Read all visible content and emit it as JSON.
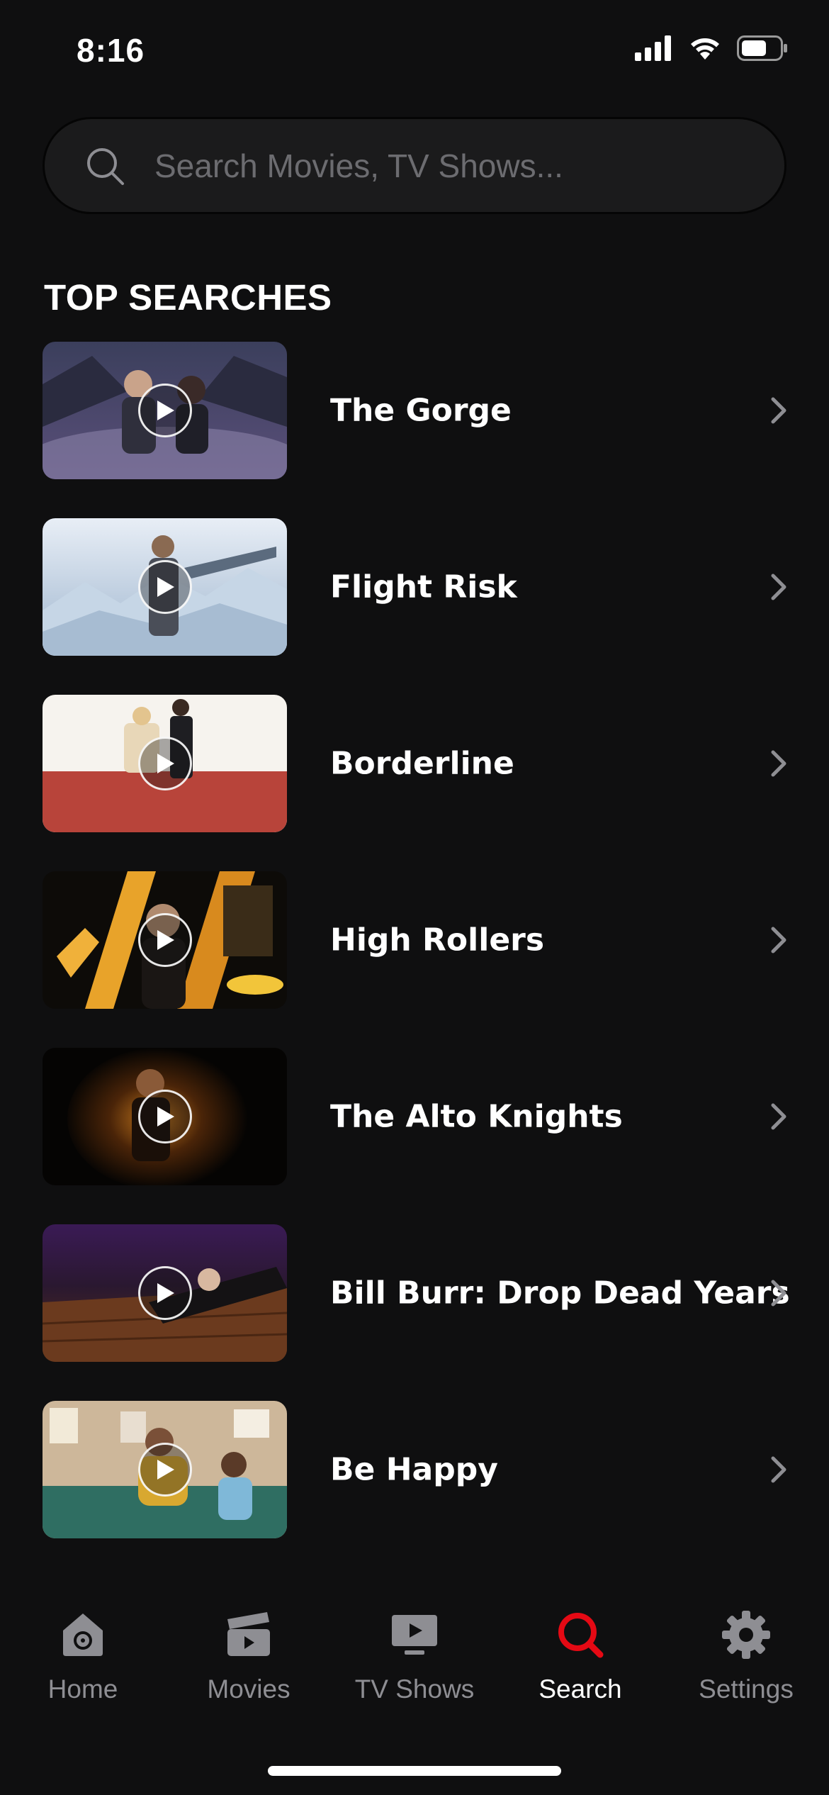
{
  "status_bar": {
    "time": "8:16"
  },
  "search": {
    "placeholder": "Search Movies, TV Shows..."
  },
  "section_title": "TOP SEARCHES",
  "items": [
    {
      "title": "The Gorge"
    },
    {
      "title": "Flight Risk"
    },
    {
      "title": "Borderline"
    },
    {
      "title": "High Rollers"
    },
    {
      "title": "The Alto Knights"
    },
    {
      "title": "Bill Burr: Drop Dead Years"
    },
    {
      "title": "Be Happy"
    }
  ],
  "tabs": [
    {
      "label": "Home",
      "icon": "home-icon",
      "active": false
    },
    {
      "label": "Movies",
      "icon": "clapperboard-icon",
      "active": false
    },
    {
      "label": "TV Shows",
      "icon": "tv-icon",
      "active": false
    },
    {
      "label": "Search",
      "icon": "search-icon",
      "active": true
    },
    {
      "label": "Settings",
      "icon": "gear-icon",
      "active": false
    }
  ],
  "colors": {
    "accent": "#e50914",
    "background": "#0f0f10",
    "inactive": "#8e8e93"
  }
}
